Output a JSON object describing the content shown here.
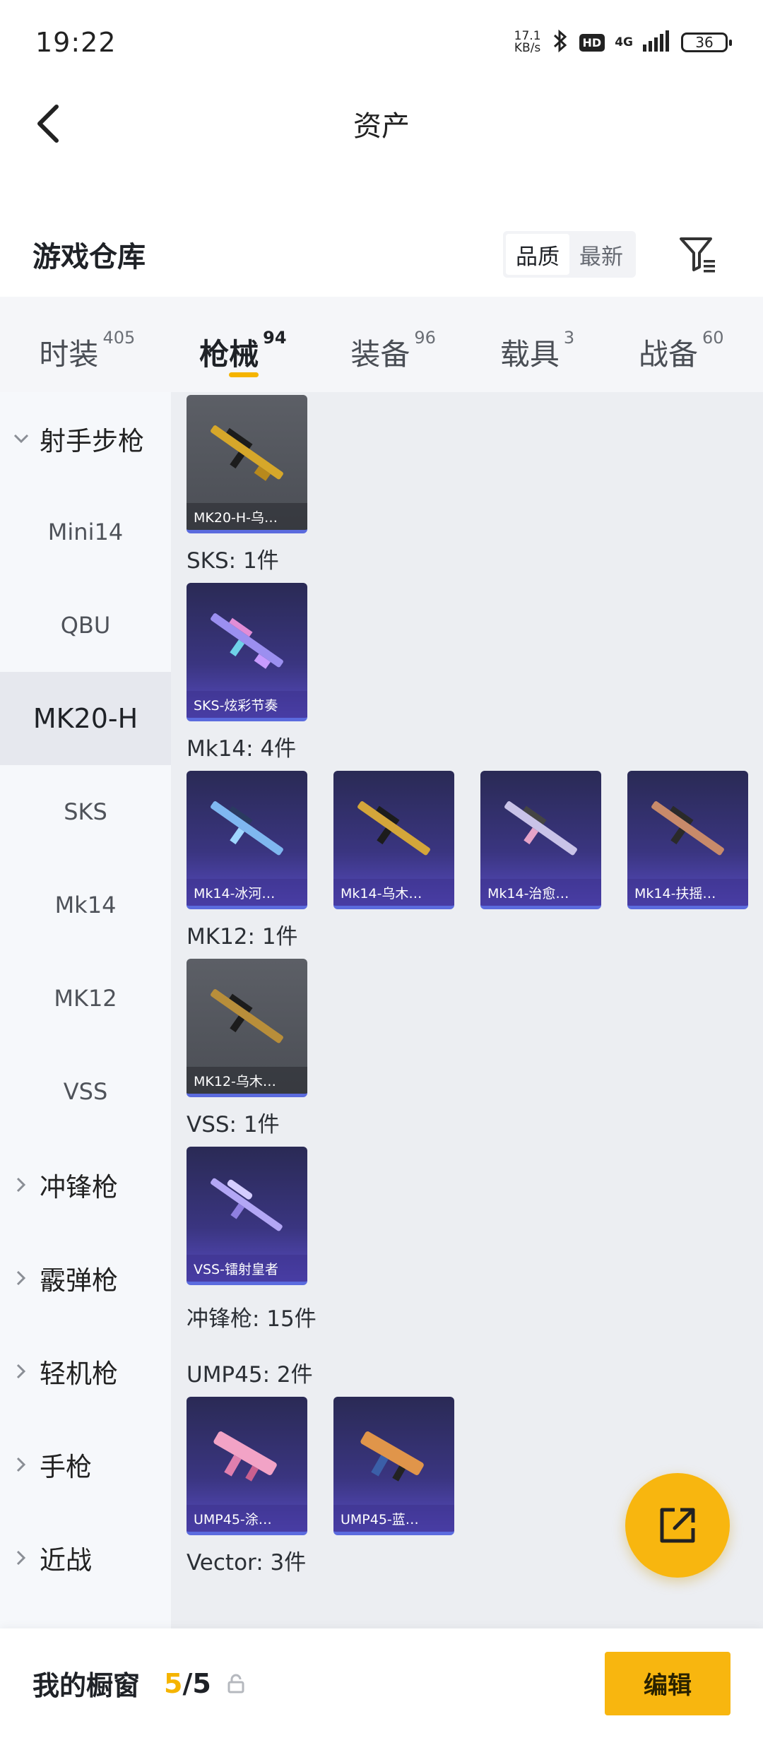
{
  "status_bar": {
    "time": "19:22",
    "net_speed_value": "17.1",
    "net_speed_unit": "KB/s",
    "hd": "HD",
    "network": "4G",
    "battery": "36"
  },
  "header": {
    "title": "资产",
    "back_icon": "chevron-left-icon"
  },
  "warehouse": {
    "title": "游戏仓库",
    "sort_options": [
      "品质",
      "最新"
    ],
    "sort_selected": "品质",
    "filter_icon": "filter-icon"
  },
  "tabs": [
    {
      "label": "时装",
      "count": "405"
    },
    {
      "label": "枪械",
      "count": "94",
      "active": true
    },
    {
      "label": "装备",
      "count": "96"
    },
    {
      "label": "载具",
      "count": "3"
    },
    {
      "label": "战备",
      "count": "60"
    }
  ],
  "sidebar": {
    "group_sniper": "射手步枪",
    "items": [
      "Mini14",
      "QBU",
      "MK20-H",
      "SKS",
      "Mk14",
      "MK12",
      "VSS"
    ],
    "active_item": "MK20-H",
    "groups": [
      "冲锋枪",
      "霰弹枪",
      "轻机枪",
      "手枪",
      "近战"
    ]
  },
  "content": {
    "mk20_cards": [
      {
        "label": "MK20-H-乌…"
      }
    ],
    "sks_label": "SKS: 1件",
    "sks_cards": [
      {
        "label": "SKS-炫彩节奏"
      }
    ],
    "mk14_label": "Mk14: 4件",
    "mk14_cards": [
      {
        "label": "Mk14-冰河…"
      },
      {
        "label": "Mk14-乌木…"
      },
      {
        "label": "Mk14-治愈…"
      },
      {
        "label": "Mk14-扶摇…"
      }
    ],
    "mk12_label": "MK12: 1件",
    "mk12_cards": [
      {
        "label": "MK12-乌木…"
      }
    ],
    "vss_label": "VSS: 1件",
    "vss_cards": [
      {
        "label": "VSS-镭射皇者"
      }
    ],
    "smg_label": "冲锋枪: 15件",
    "ump_label": "UMP45: 2件",
    "ump_cards": [
      {
        "label": "UMP45-涂…"
      },
      {
        "label": "UMP45-蓝…"
      }
    ],
    "vector_label": "Vector: 3件"
  },
  "fab": {
    "icon": "share-icon"
  },
  "bottom_bar": {
    "label": "我的橱窗",
    "current": "5",
    "total": "/5",
    "lock_icon": "lock-icon",
    "edit_label": "编辑"
  },
  "colors": {
    "accent": "#f8b60f",
    "card_purple": "#3a3580",
    "card_grey": "#55585f"
  }
}
